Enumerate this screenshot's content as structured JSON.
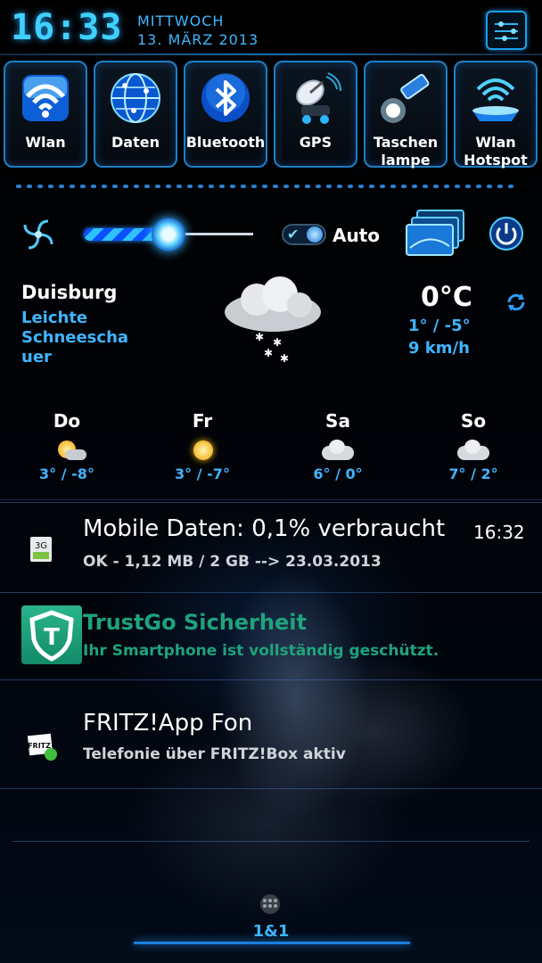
{
  "status": {
    "time": "16:33",
    "day": "MITTWOCH",
    "date": "13. MÄRZ 2013"
  },
  "toggles": [
    {
      "label": "Wlan",
      "icon": "wifi-icon"
    },
    {
      "label": "Daten",
      "icon": "globe-icon"
    },
    {
      "label": "Bluetooth",
      "icon": "bluetooth-icon"
    },
    {
      "label": "GPS",
      "icon": "satellite-icon"
    },
    {
      "label": "Taschen\nlampe",
      "line1": "Taschen",
      "line2": "lampe",
      "icon": "flashlight-icon"
    },
    {
      "label": "Wlan\nHotspot",
      "line1": "Wlan",
      "line2": "Hotspot",
      "icon": "hotspot-icon"
    }
  ],
  "controls": {
    "brightness_level": 0.5,
    "auto_label": "Auto",
    "auto_enabled": true
  },
  "weather": {
    "city": "Duisburg",
    "condition_lines": [
      "Leichte",
      "Schneescha",
      "uer"
    ],
    "temp": "0°C",
    "hi_lo": "1° / -5°",
    "wind": "9 km/h",
    "forecast": [
      {
        "day": "Do",
        "temps": "3° / -8°",
        "icon": "sun-cloud-icon"
      },
      {
        "day": "Fr",
        "temps": "3° / -7°",
        "icon": "sun-icon"
      },
      {
        "day": "Sa",
        "temps": "6° / 0°",
        "icon": "cloud-icon"
      },
      {
        "day": "So",
        "temps": "7° / 2°",
        "icon": "cloud-icon"
      }
    ]
  },
  "notifications": [
    {
      "title": "Mobile Daten: 0,1% verbraucht",
      "time": "16:32",
      "subtitle": "OK - 1,12 MB / 2 GB --> 23.03.2013",
      "icon_text": "3G"
    },
    {
      "title": "TrustGo Sicherheit",
      "subtitle": "Ihr Smartphone ist vollständig geschützt.",
      "icon_text": "T"
    },
    {
      "title": "FRITZ!App Fon",
      "subtitle": "Telefonie über FRITZ!Box aktiv",
      "icon_text": "FRITZ"
    }
  ],
  "home": {
    "page_indicator": "1&1"
  },
  "colors": {
    "accent": "#3fb5ff",
    "trustgo": "#1fa37c"
  }
}
